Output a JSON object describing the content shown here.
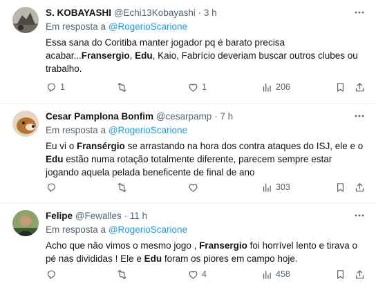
{
  "tweets": [
    {
      "name": "S. KOBAYASHI",
      "handle": "@Echi13Kobayashi",
      "time": "· 3 h",
      "reply_prefix": "Em resposta a",
      "reply_to": "@RogerioScarione",
      "body": [
        {
          "t": "Essa sana do Coritiba manter jogador pq é barato precisa acabar...",
          "b": false
        },
        {
          "t": "Fransergio",
          "b": true
        },
        {
          "t": ", ",
          "b": false
        },
        {
          "t": "Edu",
          "b": true
        },
        {
          "t": ", Kaio, Fabrício deveriam buscar outros clubes ou trabalho.",
          "b": false
        }
      ],
      "replies": "1",
      "retweets": "",
      "likes": "1",
      "views": "206"
    },
    {
      "name": "Cesar Pamplona Bonfim",
      "handle": "@cesarpamp",
      "time": "· 7 h",
      "reply_prefix": "Em resposta a",
      "reply_to": "@RogerioScarione",
      "body": [
        {
          "t": "Eu vi o ",
          "b": false
        },
        {
          "t": "Fransérgio",
          "b": true
        },
        {
          "t": " se arrastando na hora dos contra ataques do ISJ, ele e o ",
          "b": false
        },
        {
          "t": "Edu",
          "b": true
        },
        {
          "t": " estão numa rotação totalmente diferente, parecem sempre estar jogando aquela pelada beneficente de final de ano",
          "b": false
        }
      ],
      "replies": "",
      "retweets": "",
      "likes": "",
      "views": "303"
    },
    {
      "name": "Felipe",
      "handle": "@Fewalles",
      "time": "· 11 h",
      "reply_prefix": "Em resposta a",
      "reply_to": "@RogerioScarione",
      "body": [
        {
          "t": "Acho que não vimos o mesmo jogo , ",
          "b": false
        },
        {
          "t": "Fransergio",
          "b": true
        },
        {
          "t": " foi horrível lento e tirava o pé nas divididas ! Ele e ",
          "b": false
        },
        {
          "t": "Edu",
          "b": true
        },
        {
          "t": " foram os piores em campo hoje.",
          "b": false
        }
      ],
      "replies": "",
      "retweets": "",
      "likes": "4",
      "views": "458"
    }
  ],
  "icons": {
    "reply": "reply-icon",
    "retweet": "retweet-icon",
    "like": "heart-icon",
    "views": "views-icon",
    "bookmark": "bookmark-icon",
    "share": "share-icon",
    "more": "more-icon"
  },
  "colors": {
    "link": "#1d9bf0",
    "secondary": "#536471",
    "text": "#0f1419",
    "divider": "#eff3f4"
  }
}
